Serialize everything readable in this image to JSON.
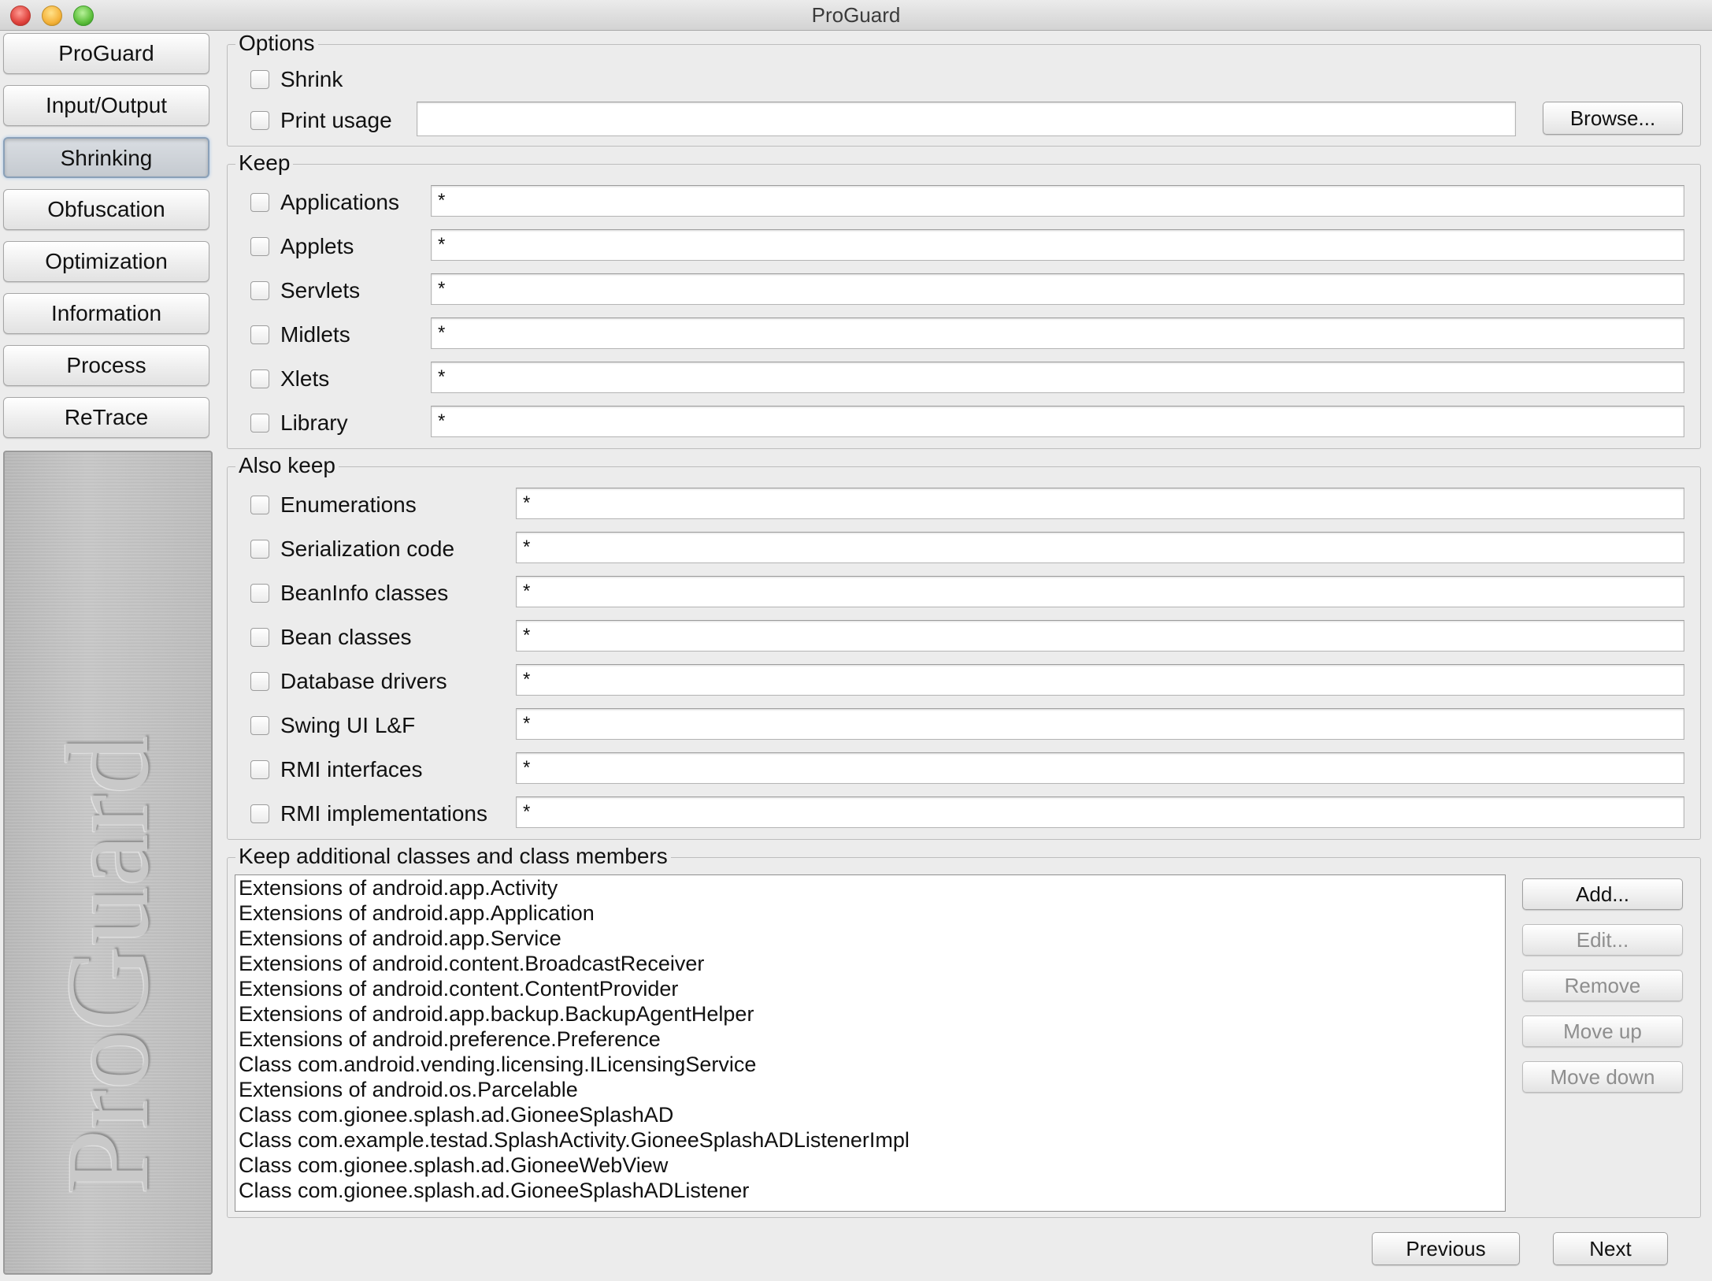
{
  "window": {
    "title": "ProGuard"
  },
  "sidebar": {
    "items": [
      {
        "label": "ProGuard"
      },
      {
        "label": "Input/Output"
      },
      {
        "label": "Shrinking"
      },
      {
        "label": "Obfuscation"
      },
      {
        "label": "Optimization"
      },
      {
        "label": "Information"
      },
      {
        "label": "Process"
      },
      {
        "label": "ReTrace"
      }
    ],
    "selected": "Shrinking",
    "logo_text": "ProGuard"
  },
  "options": {
    "title": "Options",
    "shrink_label": "Shrink",
    "shrink_checked": false,
    "print_usage_label": "Print usage",
    "print_usage_checked": false,
    "print_usage_value": "",
    "browse_label": "Browse..."
  },
  "keep": {
    "title": "Keep",
    "items": [
      {
        "label": "Applications",
        "value": "*",
        "checked": false
      },
      {
        "label": "Applets",
        "value": "*",
        "checked": false
      },
      {
        "label": "Servlets",
        "value": "*",
        "checked": false
      },
      {
        "label": "Midlets",
        "value": "*",
        "checked": false
      },
      {
        "label": "Xlets",
        "value": "*",
        "checked": false
      },
      {
        "label": "Library",
        "value": "*",
        "checked": false
      }
    ]
  },
  "also_keep": {
    "title": "Also keep",
    "items": [
      {
        "label": "Enumerations",
        "value": "*",
        "checked": false
      },
      {
        "label": "Serialization code",
        "value": "*",
        "checked": false
      },
      {
        "label": "BeanInfo classes",
        "value": "*",
        "checked": false
      },
      {
        "label": "Bean classes",
        "value": "*",
        "checked": false
      },
      {
        "label": "Database drivers",
        "value": "*",
        "checked": false
      },
      {
        "label": "Swing UI L&F",
        "value": "*",
        "checked": false
      },
      {
        "label": "RMI interfaces",
        "value": "*",
        "checked": false
      },
      {
        "label": "RMI implementations",
        "value": "*",
        "checked": false
      }
    ]
  },
  "keep_additional": {
    "title": "Keep additional classes and class members",
    "entries": [
      "Extensions of android.app.Activity",
      "Extensions of android.app.Application",
      "Extensions of android.app.Service",
      "Extensions of android.content.BroadcastReceiver",
      "Extensions of android.content.ContentProvider",
      "Extensions of android.app.backup.BackupAgentHelper",
      "Extensions of android.preference.Preference",
      "Class com.android.vending.licensing.ILicensingService",
      "Extensions of android.os.Parcelable",
      "Class com.gionee.splash.ad.GioneeSplashAD",
      "Class com.example.testad.SplashActivity.GioneeSplashADListenerImpl",
      "Class com.gionee.splash.ad.GioneeWebView",
      "Class com.gionee.splash.ad.GioneeSplashADListener"
    ],
    "buttons": {
      "add": "Add...",
      "edit": "Edit...",
      "remove": "Remove",
      "move_up": "Move up",
      "move_down": "Move down"
    }
  },
  "footer": {
    "previous_label": "Previous",
    "next_label": "Next"
  }
}
